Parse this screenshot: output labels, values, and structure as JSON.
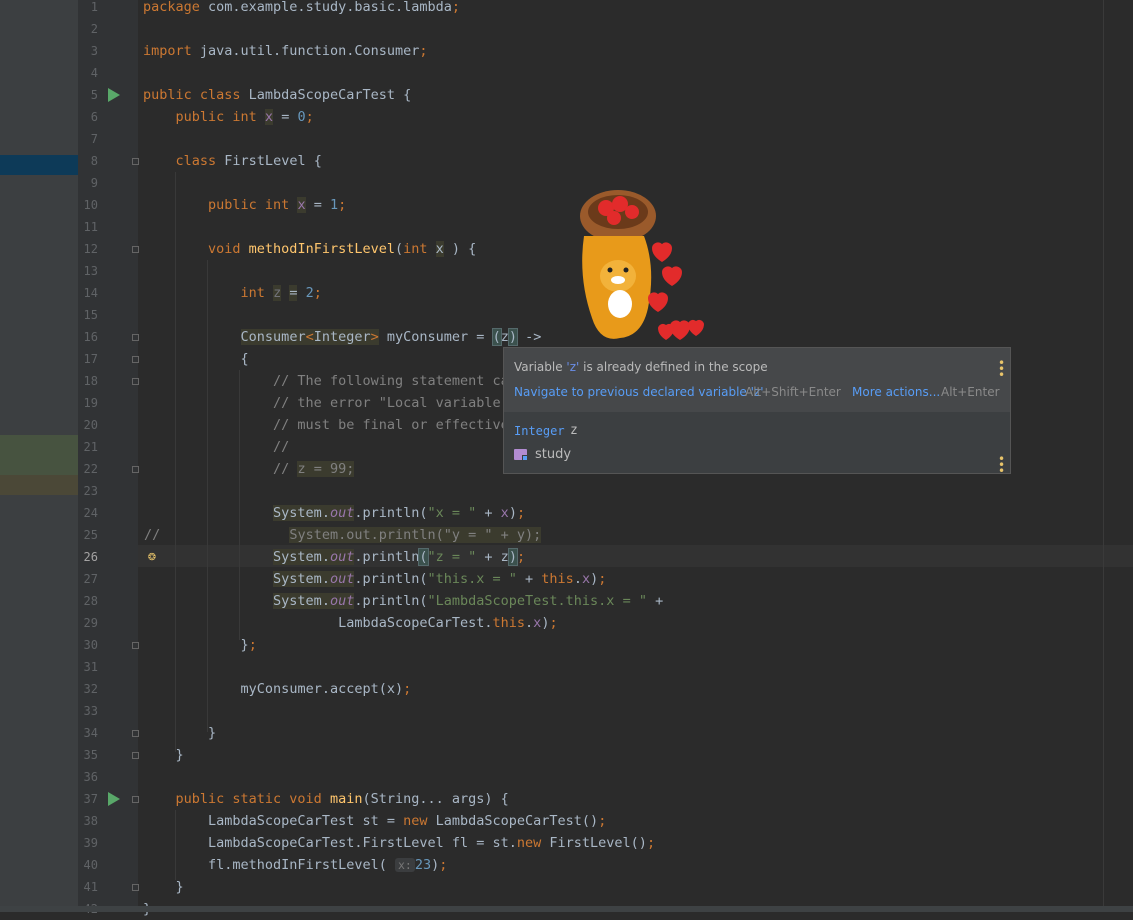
{
  "lines": [
    {
      "n": "1",
      "segs": [
        [
          "kw",
          "package "
        ],
        [
          "",
          "com.example.study.basic.lambda"
        ],
        [
          "kw",
          ";"
        ]
      ]
    },
    {
      "n": "2",
      "segs": []
    },
    {
      "n": "3",
      "segs": [
        [
          "kw",
          "import "
        ],
        [
          "",
          "java.util.function.Consumer"
        ],
        [
          "kw",
          ";"
        ]
      ]
    },
    {
      "n": "4",
      "segs": []
    },
    {
      "n": "5",
      "segs": [
        [
          "kw",
          "public class "
        ],
        [
          "",
          "LambdaScopeCarTest "
        ],
        [
          "br",
          "{"
        ]
      ]
    },
    {
      "n": "6",
      "segs": [
        [
          "",
          "    "
        ],
        [
          "kw",
          "public int "
        ],
        [
          "fld hl2",
          "x"
        ],
        [
          "",
          " = "
        ],
        [
          "num",
          "0"
        ],
        [
          "kw",
          ";"
        ]
      ]
    },
    {
      "n": "7",
      "segs": []
    },
    {
      "n": "8",
      "segs": [
        [
          "",
          "    "
        ],
        [
          "kw",
          "class "
        ],
        [
          "",
          "FirstLevel "
        ],
        [
          "br",
          "{"
        ]
      ]
    },
    {
      "n": "9",
      "segs": []
    },
    {
      "n": "10",
      "segs": [
        [
          "",
          "        "
        ],
        [
          "kw",
          "public int "
        ],
        [
          "fld hl2",
          "x"
        ],
        [
          "",
          " = "
        ],
        [
          "num",
          "1"
        ],
        [
          "kw",
          ";"
        ]
      ]
    },
    {
      "n": "11",
      "segs": []
    },
    {
      "n": "12",
      "segs": [
        [
          "",
          "        "
        ],
        [
          "kw",
          "void "
        ],
        [
          "fn",
          "methodInFirstLevel"
        ],
        [
          "",
          "("
        ],
        [
          "kw",
          "int "
        ],
        [
          "hl2",
          "x"
        ],
        [
          "",
          " ) "
        ],
        [
          "br",
          "{"
        ]
      ]
    },
    {
      "n": "13",
      "segs": []
    },
    {
      "n": "14",
      "segs": [
        [
          "",
          "            "
        ],
        [
          "kw",
          "int "
        ],
        [
          "unused",
          "z"
        ],
        [
          "",
          " "
        ],
        [
          "hl2",
          "="
        ],
        [
          "",
          " "
        ],
        [
          "num",
          "2"
        ],
        [
          "kw",
          ";"
        ]
      ]
    },
    {
      "n": "15",
      "segs": []
    },
    {
      "n": "16",
      "segs": [
        [
          "",
          "            "
        ],
        [
          "hl2",
          "Consumer"
        ],
        [
          "kw hl2",
          "<"
        ],
        [
          "hl2",
          "Integer"
        ],
        [
          "kw hl2",
          ">"
        ],
        [
          "",
          " myConsumer = "
        ],
        [
          "match",
          "("
        ],
        [
          "",
          "z"
        ],
        [
          "match",
          ")"
        ],
        [
          "",
          " ->"
        ]
      ]
    },
    {
      "n": "17",
      "segs": [
        [
          "",
          "            "
        ],
        [
          "br",
          "{"
        ]
      ]
    },
    {
      "n": "18",
      "segs": [
        [
          "",
          "                "
        ],
        [
          "cm",
          "// The following statement ca"
        ]
      ]
    },
    {
      "n": "19",
      "segs": [
        [
          "",
          "                "
        ],
        [
          "cm",
          "// the error \"Local variable "
        ]
      ]
    },
    {
      "n": "20",
      "segs": [
        [
          "",
          "                "
        ],
        [
          "cm",
          "// must be final or effective"
        ]
      ]
    },
    {
      "n": "21",
      "segs": [
        [
          "",
          "                "
        ],
        [
          "cm",
          "//"
        ]
      ]
    },
    {
      "n": "22",
      "segs": [
        [
          "",
          "                "
        ],
        [
          "cm",
          "// "
        ],
        [
          "cm hl2",
          "z = 99;"
        ]
      ]
    },
    {
      "n": "23",
      "segs": []
    },
    {
      "n": "24",
      "segs": [
        [
          "",
          "                "
        ],
        [
          "hl2",
          "System."
        ],
        [
          "fi hl2",
          "out"
        ],
        [
          "",
          ".println("
        ],
        [
          "str",
          "\"x = \""
        ],
        [
          "",
          " + "
        ],
        [
          "fld",
          "x"
        ],
        [
          "",
          ")"
        ],
        [
          "kw",
          ";"
        ]
      ]
    },
    {
      "n": "25",
      "segs": [
        [
          "",
          "                  "
        ],
        [
          "cm hl2",
          "System.out.println(\"y = \" + y);"
        ]
      ]
    },
    {
      "n": "26",
      "segs": [
        [
          "",
          "                "
        ],
        [
          "hl2",
          "System."
        ],
        [
          "fi hl2",
          "out"
        ],
        [
          "",
          ".println"
        ],
        [
          "match",
          "("
        ],
        [
          "str",
          "\"z = \""
        ],
        [
          "",
          " + z"
        ],
        [
          "match",
          ")"
        ],
        [
          "kw",
          ";"
        ]
      ]
    },
    {
      "n": "27",
      "segs": [
        [
          "",
          "                "
        ],
        [
          "hl2",
          "System."
        ],
        [
          "fi hl2",
          "out"
        ],
        [
          "",
          ".println("
        ],
        [
          "str",
          "\"this.x = \""
        ],
        [
          "",
          " + "
        ],
        [
          "kw",
          "this"
        ],
        [
          "",
          "."
        ],
        [
          "fld",
          "x"
        ],
        [
          "",
          ")"
        ],
        [
          "kw",
          ";"
        ]
      ]
    },
    {
      "n": "28",
      "segs": [
        [
          "",
          "                "
        ],
        [
          "hl2",
          "System."
        ],
        [
          "fi hl2",
          "out"
        ],
        [
          "",
          ".println("
        ],
        [
          "str",
          "\"LambdaScopeTest.this.x = \""
        ],
        [
          "",
          " +"
        ]
      ]
    },
    {
      "n": "29",
      "segs": [
        [
          "",
          "                        "
        ],
        [
          "",
          "LambdaScopeCarTest."
        ],
        [
          "kw",
          "this"
        ],
        [
          "",
          "."
        ],
        [
          "fld",
          "x"
        ],
        [
          "",
          ")"
        ],
        [
          "kw",
          ";"
        ]
      ]
    },
    {
      "n": "30",
      "segs": [
        [
          "",
          "            "
        ],
        [
          "br",
          "}"
        ],
        [
          "kw",
          ";"
        ]
      ]
    },
    {
      "n": "31",
      "segs": []
    },
    {
      "n": "32",
      "segs": [
        [
          "",
          "            "
        ],
        [
          "",
          "myConsumer.accept(x)"
        ],
        [
          "kw",
          ";"
        ]
      ]
    },
    {
      "n": "33",
      "segs": []
    },
    {
      "n": "34",
      "segs": [
        [
          "",
          "        "
        ],
        [
          "br",
          "}"
        ]
      ]
    },
    {
      "n": "35",
      "segs": [
        [
          "",
          "    "
        ],
        [
          "br",
          "}"
        ]
      ]
    },
    {
      "n": "36",
      "segs": []
    },
    {
      "n": "37",
      "segs": [
        [
          "",
          "    "
        ],
        [
          "kw",
          "public static void "
        ],
        [
          "fn",
          "main"
        ],
        [
          "",
          "(String... args) "
        ],
        [
          "br",
          "{"
        ]
      ]
    },
    {
      "n": "38",
      "segs": [
        [
          "",
          "        "
        ],
        [
          "",
          "LambdaScopeCarTest st = "
        ],
        [
          "kw",
          "new "
        ],
        [
          "",
          "LambdaScopeCarTest()"
        ],
        [
          "kw",
          ";"
        ]
      ]
    },
    {
      "n": "39",
      "segs": [
        [
          "",
          "        "
        ],
        [
          "",
          "LambdaScopeCarTest.FirstLevel fl = st."
        ],
        [
          "kw",
          "new "
        ],
        [
          "",
          "FirstLevel()"
        ],
        [
          "kw",
          ";"
        ]
      ]
    },
    {
      "n": "40",
      "segs": [
        [
          "",
          "        "
        ],
        [
          "",
          "fl.methodInFirstLevel( "
        ],
        [
          "hint",
          "x:"
        ],
        [
          "num",
          "23"
        ],
        [
          "",
          ")"
        ],
        [
          "kw",
          ";"
        ]
      ]
    },
    {
      "n": "41",
      "segs": [
        [
          "",
          "    "
        ],
        [
          "br",
          "}"
        ]
      ]
    },
    {
      "n": "42",
      "segs": [
        [
          "",
          "}"
        ]
      ]
    }
  ],
  "line25_comment_marker": "//",
  "popup": {
    "message_prefix": "Variable ",
    "message_var": "'z'",
    "message_suffix": " is already defined in the scope",
    "navigate_label": "Navigate to previous declared variable 'z'",
    "navigate_shortcut": "Alt+Shift+Enter",
    "more_actions_label": "More actions...",
    "more_actions_shortcut": "Alt+Enter",
    "type_name": "Integer",
    "var_name": "z",
    "module_name": "study"
  },
  "colors": {
    "background": "#2b2b2b",
    "keyword": "#cc7832",
    "number": "#6897bb",
    "string": "#6a8759",
    "comment": "#808080",
    "field": "#9876aa",
    "method_decl": "#ffc66d",
    "link": "#589df6",
    "run": "#59a869"
  }
}
